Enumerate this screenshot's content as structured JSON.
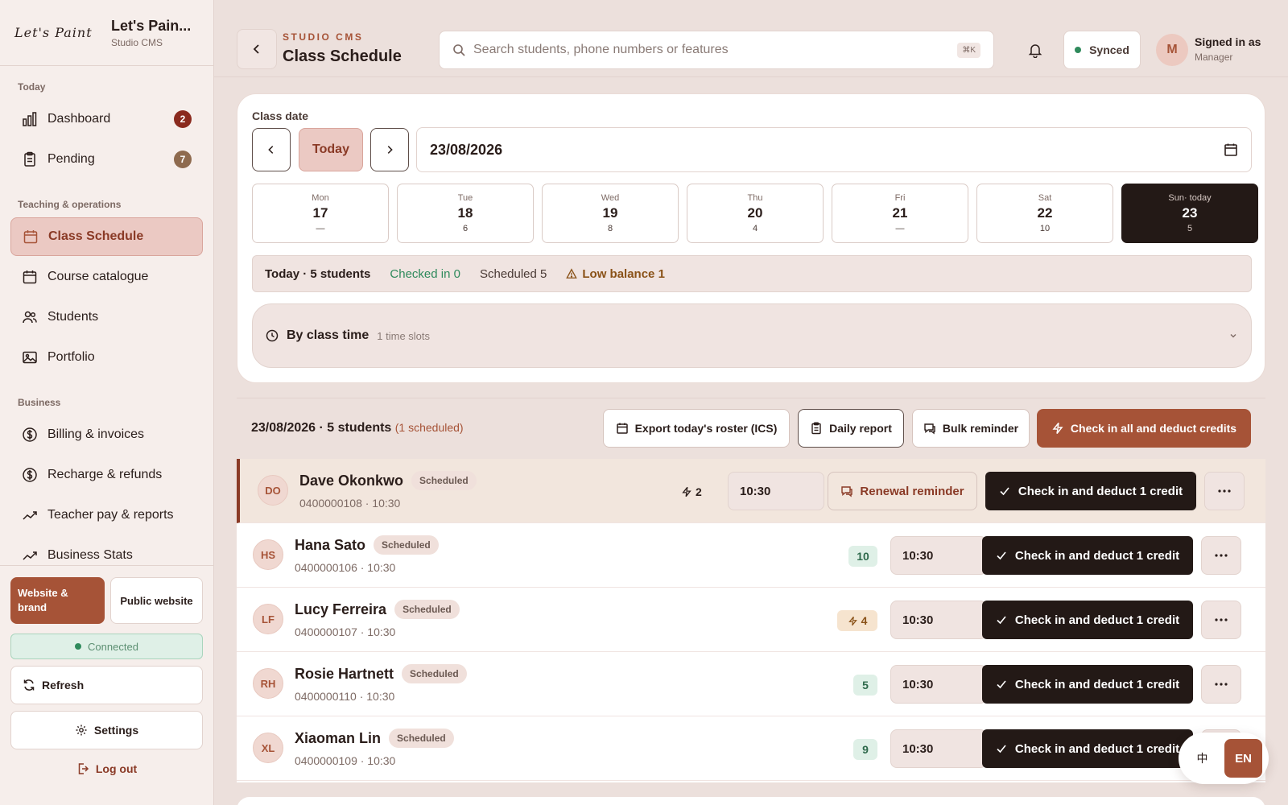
{
  "brand": {
    "logo_text": "Let's Paint",
    "name": "Let's Pain...",
    "sub": "Studio CMS"
  },
  "colors": {
    "accent": "#a65337",
    "accent_soft": "#ebc9c3",
    "dark": "#231916",
    "success": "#2f8a5c",
    "warning": "#8a5218"
  },
  "sidebar": {
    "sections": {
      "today": "Today",
      "teaching": "Teaching & operations",
      "business": "Business"
    },
    "items": {
      "dashboard": {
        "label": "Dashboard",
        "badge": "2",
        "icon": "bar-chart-icon"
      },
      "pending": {
        "label": "Pending",
        "badge": "7",
        "icon": "clipboard-icon"
      },
      "class_schedule": {
        "label": "Class Schedule",
        "icon": "calendar-icon"
      },
      "course_catalogue": {
        "label": "Course catalogue",
        "icon": "calendar-icon"
      },
      "students": {
        "label": "Students",
        "icon": "users-icon"
      },
      "portfolio": {
        "label": "Portfolio",
        "icon": "image-icon"
      },
      "billing": {
        "label": "Billing & invoices",
        "icon": "dollar-icon"
      },
      "recharge": {
        "label": "Recharge & refunds",
        "icon": "dollar-icon"
      },
      "teacher_pay": {
        "label": "Teacher pay & reports",
        "icon": "trend-icon"
      },
      "business_stats": {
        "label": "Business Stats",
        "icon": "trend-icon"
      }
    },
    "website_brand": "Website & brand",
    "public_website": "Public website",
    "connected": "Connected",
    "refresh": "Refresh",
    "settings": "Settings",
    "logout": "Log out"
  },
  "header": {
    "eyebrow": "STUDIO CMS",
    "title": "Class Schedule",
    "search_placeholder": "Search students, phone numbers or features",
    "search_shortcut": "⌘K",
    "synced": "Synced",
    "avatar_initial": "M",
    "signed_in": "Signed in as",
    "role": "Manager"
  },
  "date_panel": {
    "label": "Class date",
    "today_btn": "Today",
    "date_value": "23/08/2026",
    "days": [
      {
        "name": "Mon",
        "date": "17",
        "count": "—"
      },
      {
        "name": "Tue",
        "date": "18",
        "count": "6"
      },
      {
        "name": "Wed",
        "date": "19",
        "count": "8"
      },
      {
        "name": "Thu",
        "date": "20",
        "count": "4"
      },
      {
        "name": "Fri",
        "date": "21",
        "count": "—"
      },
      {
        "name": "Sat",
        "date": "22",
        "count": "10"
      },
      {
        "name": "Sun· today",
        "date": "23",
        "count": "5",
        "selected": true
      }
    ],
    "summary": {
      "today": "Today · 5 students",
      "checked_in": "Checked in 0",
      "scheduled": "Scheduled 5",
      "low_balance": "Low balance 1"
    },
    "slots": {
      "title": "By class time",
      "sub": "1 time slots"
    }
  },
  "roster": {
    "title": "23/08/2026 · 5 students",
    "scheduled_note": "(1 scheduled)",
    "export": "Export today's roster (ICS)",
    "daily_report": "Daily report",
    "bulk_reminder": "Bulk reminder",
    "check_in_all": "Check in all and deduct credits",
    "checkin_label": "Check in and deduct 1 credit",
    "renewal_label": "Renewal reminder",
    "status": "Scheduled",
    "students": [
      {
        "initials": "DO",
        "name": "Dave Okonkwo",
        "sub": "0400000108 · 10:30",
        "credit": "2",
        "credit_style": "plain",
        "time": "10:30",
        "renewal": true
      },
      {
        "initials": "HS",
        "name": "Hana Sato",
        "sub": "0400000106 · 10:30",
        "credit": "10",
        "credit_style": "ok",
        "time": "10:30"
      },
      {
        "initials": "LF",
        "name": "Lucy Ferreira",
        "sub": "0400000107 · 10:30",
        "credit": "4",
        "credit_style": "low",
        "time": "10:30"
      },
      {
        "initials": "RH",
        "name": "Rosie Hartnett",
        "sub": "0400000110 · 10:30",
        "credit": "5",
        "credit_style": "ok",
        "time": "10:30"
      },
      {
        "initials": "XL",
        "name": "Xiaoman Lin",
        "sub": "0400000109 · 10:30",
        "credit": "9",
        "credit_style": "ok",
        "time": "10:30"
      }
    ]
  },
  "lang": {
    "zh": "中",
    "en": "EN"
  }
}
